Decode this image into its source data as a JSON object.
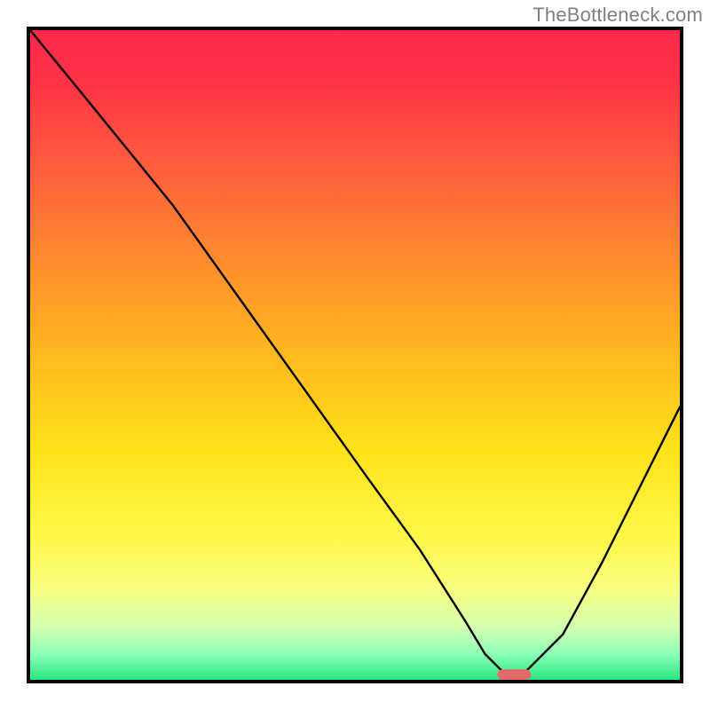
{
  "watermark": "TheBottleneck.com",
  "chart_data": {
    "type": "line",
    "title": "",
    "xlabel": "",
    "ylabel": "",
    "xlim": [
      0,
      100
    ],
    "ylim": [
      0,
      100
    ],
    "grid": false,
    "legend": false,
    "background": {
      "type": "vertical-gradient",
      "stops": [
        {
          "pos": 0.0,
          "color": "#ff2a4b"
        },
        {
          "pos": 0.08,
          "color": "#ff3347"
        },
        {
          "pos": 0.2,
          "color": "#ff5a3d"
        },
        {
          "pos": 0.35,
          "color": "#ff8a2f"
        },
        {
          "pos": 0.5,
          "color": "#ffb91f"
        },
        {
          "pos": 0.65,
          "color": "#ffe21a"
        },
        {
          "pos": 0.78,
          "color": "#fff84a"
        },
        {
          "pos": 0.86,
          "color": "#f7ff80"
        },
        {
          "pos": 0.92,
          "color": "#d3ffb0"
        },
        {
          "pos": 0.96,
          "color": "#8cffb8"
        },
        {
          "pos": 1.0,
          "color": "#29e67f"
        }
      ]
    },
    "series": [
      {
        "name": "bottleneck-curve",
        "color": "#000000",
        "x": [
          0,
          9,
          22,
          32,
          42,
          52,
          60,
          67,
          70,
          73,
          76,
          82,
          88,
          94,
          100
        ],
        "y": [
          100,
          89,
          73,
          59,
          45,
          31,
          20,
          9,
          4,
          1,
          1,
          7,
          18,
          30,
          42
        ]
      }
    ],
    "marker": {
      "name": "optimal-point",
      "x_center": 74.5,
      "y_center": 0.8,
      "color": "#e46a6a",
      "shape": "pill"
    }
  }
}
